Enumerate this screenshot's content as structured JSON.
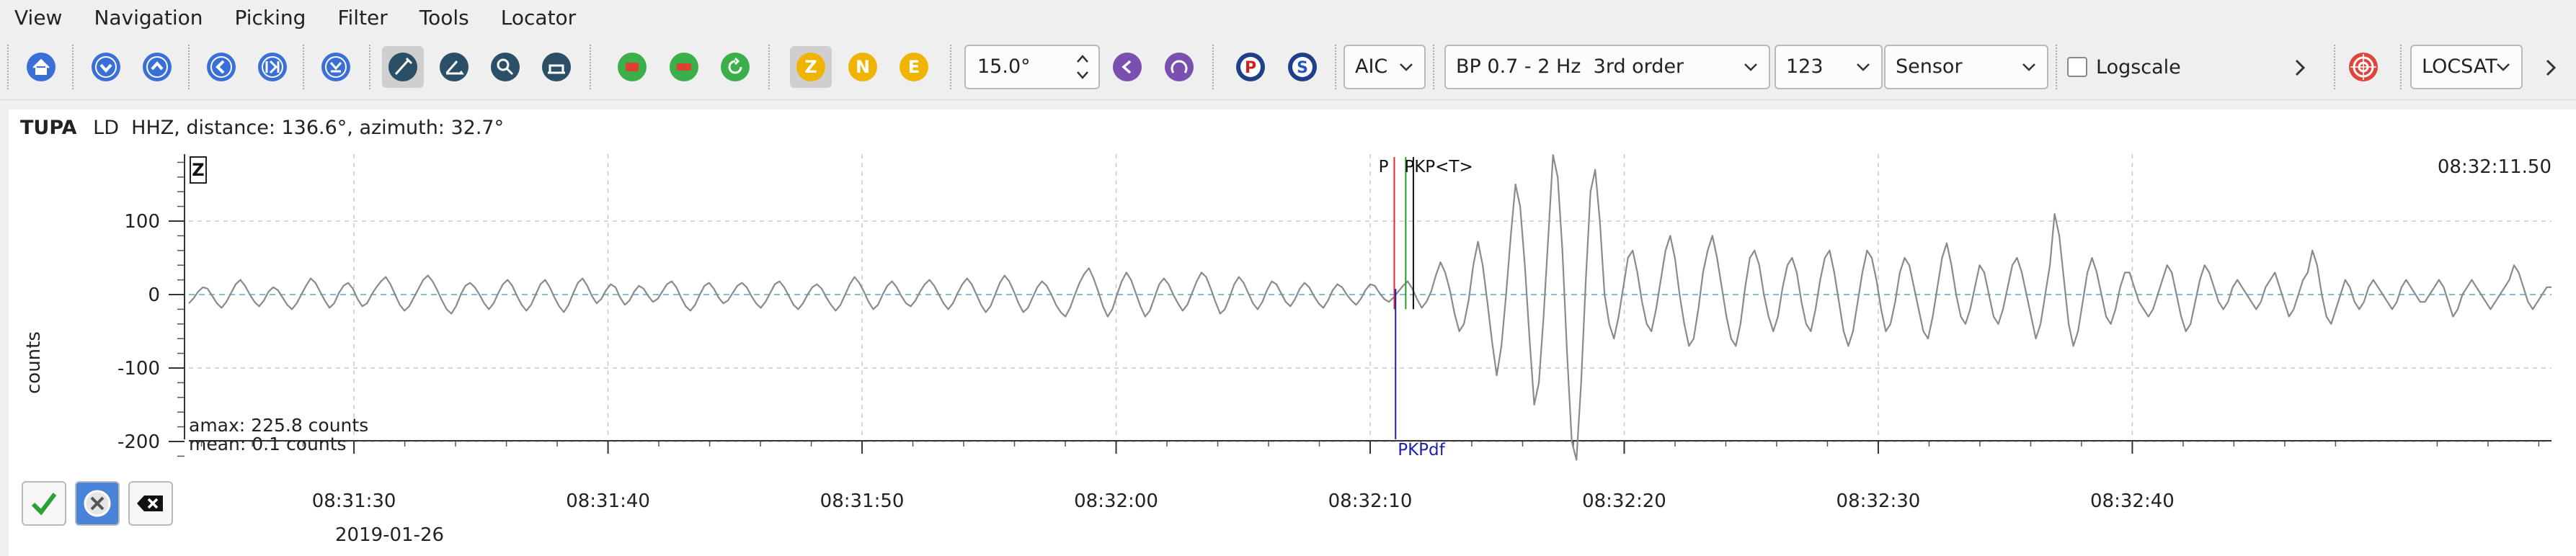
{
  "menubar": {
    "items": [
      "View",
      "Navigation",
      "Picking",
      "Filter",
      "Tools",
      "Locator"
    ]
  },
  "toolbar": {
    "components": [
      "Z",
      "N",
      "E"
    ],
    "component_colors": {
      "Z": "#f0b400",
      "N": "#f0b400",
      "E": "#f0b400"
    },
    "phase_buttons": [
      "P",
      "S"
    ],
    "phase_colors": {
      "P": "#cc2222",
      "S": "#2255cc"
    },
    "angle_value": "15.0°",
    "picker": "AIC",
    "filter": "BP 0.7 - 2 Hz  3rd order",
    "channel": "123",
    "unit_mode": "Sensor",
    "logscale_label": "Logscale",
    "logscale_checked": false,
    "locator": "LOCSAT",
    "icons": [
      "home-icon",
      "circle-down-icon",
      "circle-up-icon",
      "circle-left-icon",
      "circle-right-icon",
      "down-arrow-icon",
      "pick-pen-icon",
      "rotate-icon",
      "zoom-trace-icon",
      "zoom-out-icon",
      "apply-green-icon",
      "apply-red-icon",
      "undo-green-icon",
      "angle-left-icon",
      "angle-right-icon",
      "target-icon"
    ]
  },
  "trace": {
    "station": "TUPA",
    "info": "LD  HHZ, distance: 136.6°, azimuth: 32.7°",
    "component_badge": "Z",
    "time_readout": "08:32:11.50",
    "ylabel": "counts",
    "amax": "amax: 225.8 counts",
    "mean": "mean: 0.1 counts",
    "date": "2019-01-26"
  },
  "chart_data": {
    "type": "line",
    "title": "",
    "xlabel": "",
    "ylabel": "counts",
    "x_ticks": [
      "08:31:30",
      "08:31:40",
      "08:31:50",
      "08:32:00",
      "08:32:10",
      "08:32:20",
      "08:32:30",
      "08:32:40"
    ],
    "y_ticks": [
      100,
      0,
      -100,
      -200
    ],
    "ylim": [
      -225,
      190
    ],
    "x_range_seconds": [
      23.5,
      116.5
    ],
    "grid": true,
    "picks": [
      {
        "label": "P",
        "t": 70.95,
        "color": "#e03030",
        "position": "top"
      },
      {
        "label": "PKP<T>",
        "t": 71.4,
        "color": "#20a020",
        "position": "top"
      },
      {
        "label": "",
        "t": 71.7,
        "color": "#111111",
        "position": "top"
      },
      {
        "label": "PKPdf",
        "t": 71.0,
        "color": "#2020b0",
        "position": "bottom"
      }
    ],
    "series": [
      {
        "color": "#8a8a8a",
        "t0": 23.5,
        "dt": 0.25,
        "values": [
          -12,
          -5,
          4,
          10,
          8,
          -2,
          -12,
          -18,
          -10,
          2,
          14,
          20,
          12,
          0,
          -10,
          -16,
          -8,
          4,
          10,
          6,
          -4,
          -14,
          -20,
          -12,
          0,
          12,
          22,
          16,
          4,
          -8,
          -18,
          -12,
          2,
          12,
          16,
          8,
          -6,
          -16,
          -12,
          0,
          10,
          18,
          24,
          14,
          0,
          -14,
          -22,
          -16,
          -4,
          8,
          20,
          26,
          18,
          6,
          -8,
          -20,
          -26,
          -16,
          0,
          12,
          16,
          10,
          0,
          -12,
          -20,
          -12,
          2,
          14,
          20,
          12,
          -2,
          -14,
          -22,
          -14,
          0,
          14,
          20,
          10,
          -4,
          -16,
          -24,
          -14,
          2,
          16,
          22,
          12,
          -2,
          -12,
          -6,
          6,
          14,
          10,
          -4,
          -14,
          -8,
          4,
          12,
          8,
          -2,
          -10,
          -6,
          4,
          14,
          18,
          10,
          -4,
          -16,
          -22,
          -14,
          0,
          12,
          16,
          8,
          -4,
          -12,
          -8,
          2,
          12,
          16,
          10,
          -2,
          -12,
          -18,
          -10,
          2,
          14,
          18,
          10,
          -2,
          -14,
          -20,
          -12,
          0,
          10,
          14,
          8,
          -4,
          -14,
          -22,
          -14,
          0,
          14,
          24,
          16,
          4,
          -10,
          -20,
          -14,
          0,
          12,
          18,
          10,
          -2,
          -12,
          -16,
          -8,
          4,
          14,
          20,
          12,
          0,
          -12,
          -20,
          -12,
          2,
          14,
          22,
          14,
          0,
          -14,
          -24,
          -16,
          0,
          16,
          26,
          18,
          4,
          -12,
          -24,
          -18,
          -4,
          10,
          18,
          12,
          0,
          -14,
          -24,
          -30,
          -18,
          0,
          16,
          28,
          36,
          22,
          4,
          -16,
          -30,
          -20,
          0,
          18,
          30,
          20,
          2,
          -16,
          -30,
          -22,
          -4,
          14,
          22,
          14,
          0,
          -12,
          -22,
          -14,
          2,
          18,
          30,
          24,
          8,
          -10,
          -26,
          -20,
          -4,
          14,
          24,
          16,
          2,
          -12,
          -20,
          -10,
          6,
          18,
          14,
          2,
          -10,
          -16,
          -6,
          8,
          16,
          10,
          -2,
          -12,
          -18,
          -8,
          6,
          14,
          10,
          0,
          -8,
          -14,
          -6,
          6,
          14,
          12,
          2,
          -6,
          -10,
          -4,
          4,
          12,
          18,
          8,
          -6,
          -18,
          -10,
          4,
          26,
          44,
          30,
          6,
          -26,
          -50,
          -40,
          -8,
          40,
          72,
          40,
          -10,
          -64,
          -110,
          -70,
          0,
          80,
          150,
          120,
          40,
          -60,
          -150,
          -120,
          -30,
          80,
          190,
          160,
          60,
          -80,
          -200,
          -225,
          -120,
          20,
          140,
          170,
          100,
          0,
          -40,
          -60,
          -30,
          10,
          50,
          60,
          30,
          -10,
          -40,
          -50,
          -20,
          20,
          60,
          80,
          50,
          0,
          -40,
          -70,
          -60,
          -20,
          30,
          60,
          80,
          50,
          10,
          -30,
          -60,
          -70,
          -40,
          10,
          50,
          60,
          40,
          0,
          -30,
          -50,
          -30,
          10,
          40,
          50,
          30,
          -10,
          -40,
          -50,
          -20,
          20,
          50,
          60,
          30,
          -10,
          -50,
          -70,
          -50,
          -10,
          30,
          60,
          50,
          20,
          -20,
          -50,
          -40,
          -10,
          30,
          50,
          40,
          10,
          -20,
          -50,
          -60,
          -30,
          10,
          50,
          70,
          40,
          0,
          -30,
          -40,
          -20,
          10,
          40,
          30,
          0,
          -30,
          -40,
          -20,
          10,
          40,
          50,
          30,
          0,
          -30,
          -60,
          -40,
          0,
          40,
          110,
          80,
          20,
          -40,
          -70,
          -50,
          -10,
          30,
          50,
          30,
          0,
          -30,
          -40,
          -20,
          10,
          30,
          30,
          10,
          -10,
          -20,
          -30,
          -20,
          0,
          20,
          40,
          30,
          0,
          -30,
          -50,
          -40,
          -10,
          20,
          40,
          30,
          10,
          -10,
          -20,
          -10,
          10,
          20,
          10,
          0,
          -10,
          -20,
          -10,
          10,
          20,
          30,
          10,
          -10,
          -30,
          -20,
          0,
          20,
          30,
          60,
          40,
          0,
          -30,
          -40,
          -20,
          0,
          20,
          10,
          -10,
          -20,
          -10,
          10,
          20,
          10,
          0,
          -10,
          -20,
          -10,
          10,
          20,
          10,
          0,
          -10,
          -10,
          0,
          10,
          20,
          10,
          -10,
          -30,
          -20,
          0,
          10,
          20,
          10,
          0,
          -10,
          -20,
          -10,
          0,
          10,
          20,
          40,
          30,
          10,
          -10,
          -20,
          -10,
          0,
          10,
          10
        ]
      }
    ]
  }
}
